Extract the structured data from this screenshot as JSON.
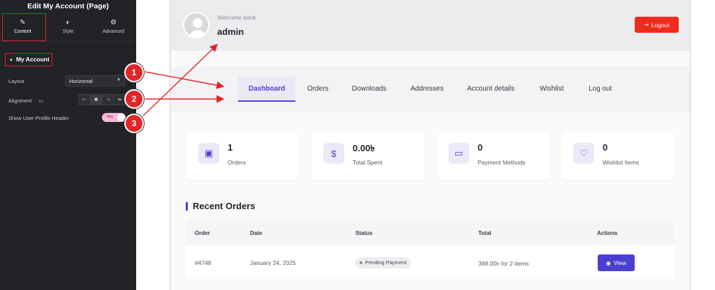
{
  "sidebar": {
    "title": "Edit My Account (Page)",
    "tabs": [
      {
        "label": "Content",
        "icon": "pencil-icon"
      },
      {
        "label": "Style",
        "icon": "contrast-icon"
      },
      {
        "label": "Advanced",
        "icon": "gear-icon"
      }
    ],
    "section": "My Account",
    "layout_label": "Layout",
    "layout_value": "Horizontal",
    "alignment_label": "Alignment",
    "profile_header_label": "Show User Profile Header",
    "profile_header_toggle": "Yes"
  },
  "header": {
    "welcome": "Welcome back",
    "username": "admin",
    "logout_label": "Logout"
  },
  "nav": {
    "tabs": [
      "Dashboard",
      "Orders",
      "Downloads",
      "Addresses",
      "Account details",
      "Wishlist",
      "Log out"
    ],
    "active": "Dashboard"
  },
  "stats": [
    {
      "value": "1",
      "label": "Orders",
      "icon": "bag-icon"
    },
    {
      "value": "0.00৳",
      "label": "Total Spent",
      "icon": "dollar-icon"
    },
    {
      "value": "0",
      "label": "Payment Methods",
      "icon": "card-icon"
    },
    {
      "value": "0",
      "label": "Wishlist Items",
      "icon": "heart-icon"
    }
  ],
  "recent": {
    "title": "Recent Orders",
    "columns": [
      "Order",
      "Date",
      "Status",
      "Total",
      "Actions"
    ],
    "rows": [
      {
        "order": "#4748",
        "date": "January 24, 2025",
        "status": "Pending Payment",
        "total": "388.00৳  for 2 items",
        "action": "View"
      }
    ]
  },
  "annotations": [
    "1",
    "2",
    "3"
  ],
  "colors": {
    "accent": "#4a3fd0",
    "logout": "#ef2b1c",
    "annotation": "#e12626",
    "toggle": "#f9b8d8"
  }
}
